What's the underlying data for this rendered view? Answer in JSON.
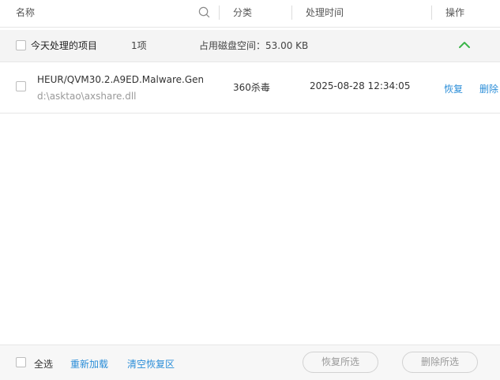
{
  "header": {
    "col_name": "名称",
    "col_category": "分类",
    "col_time": "处理时间",
    "col_action": "操作"
  },
  "group": {
    "title": "今天处理的项目",
    "count": "1项",
    "disk_usage": "占用磁盘空间：53.00 KB"
  },
  "items": [
    {
      "name": "HEUR/QVM30.2.A9ED.Malware.Gen",
      "path": "d:\\asktao\\axshare.dll",
      "category": "360杀毒",
      "time": "2025-08-28 12:34:05",
      "restore_label": "恢复",
      "delete_label": "删除"
    }
  ],
  "footer": {
    "select_all_label": "全选",
    "reload_label": "重新加载",
    "clear_label": "清空恢复区",
    "restore_selected_label": "恢复所选",
    "delete_selected_label": "删除所选"
  },
  "colors": {
    "link": "#2b8ed8",
    "chevron": "#3bb54a",
    "group_bg": "#f4f4f4"
  },
  "icons": {
    "search": "search-icon",
    "collapse": "chevron-up-icon"
  }
}
